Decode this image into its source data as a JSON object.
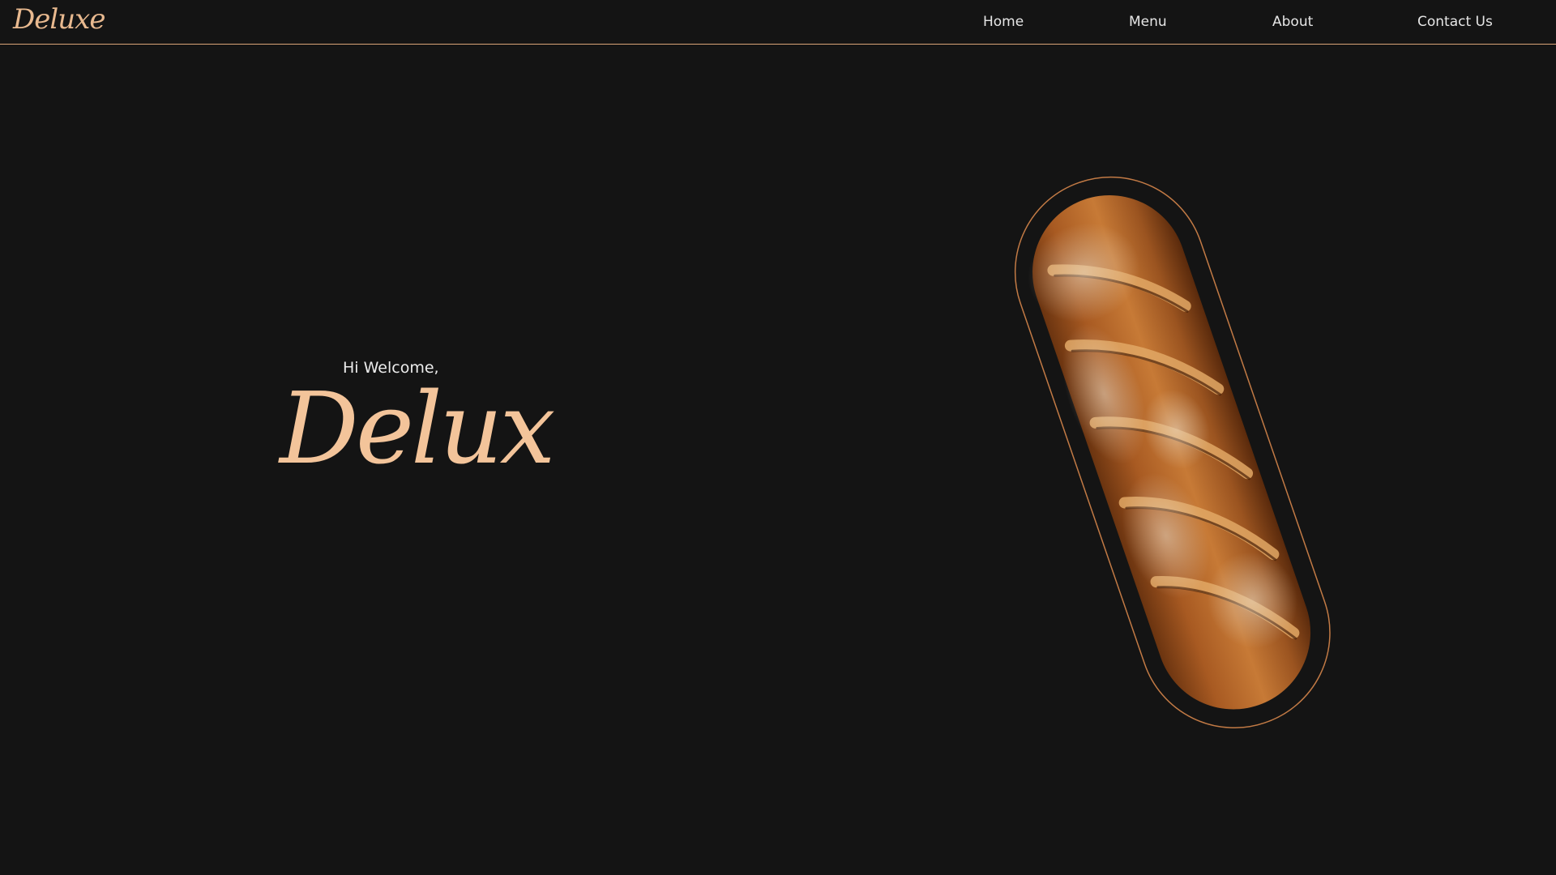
{
  "nav": {
    "logo": "Deluxe",
    "links": [
      "Home",
      "Menu",
      "About",
      "Contact Us"
    ]
  },
  "hero": {
    "greeting": "Hi Welcome,",
    "title": "Delux",
    "image_alt": "baguette"
  },
  "colors": {
    "background": "#141414",
    "accent": "#f3c49a",
    "outline": "#c27a45",
    "text": "#e6e6e6"
  }
}
